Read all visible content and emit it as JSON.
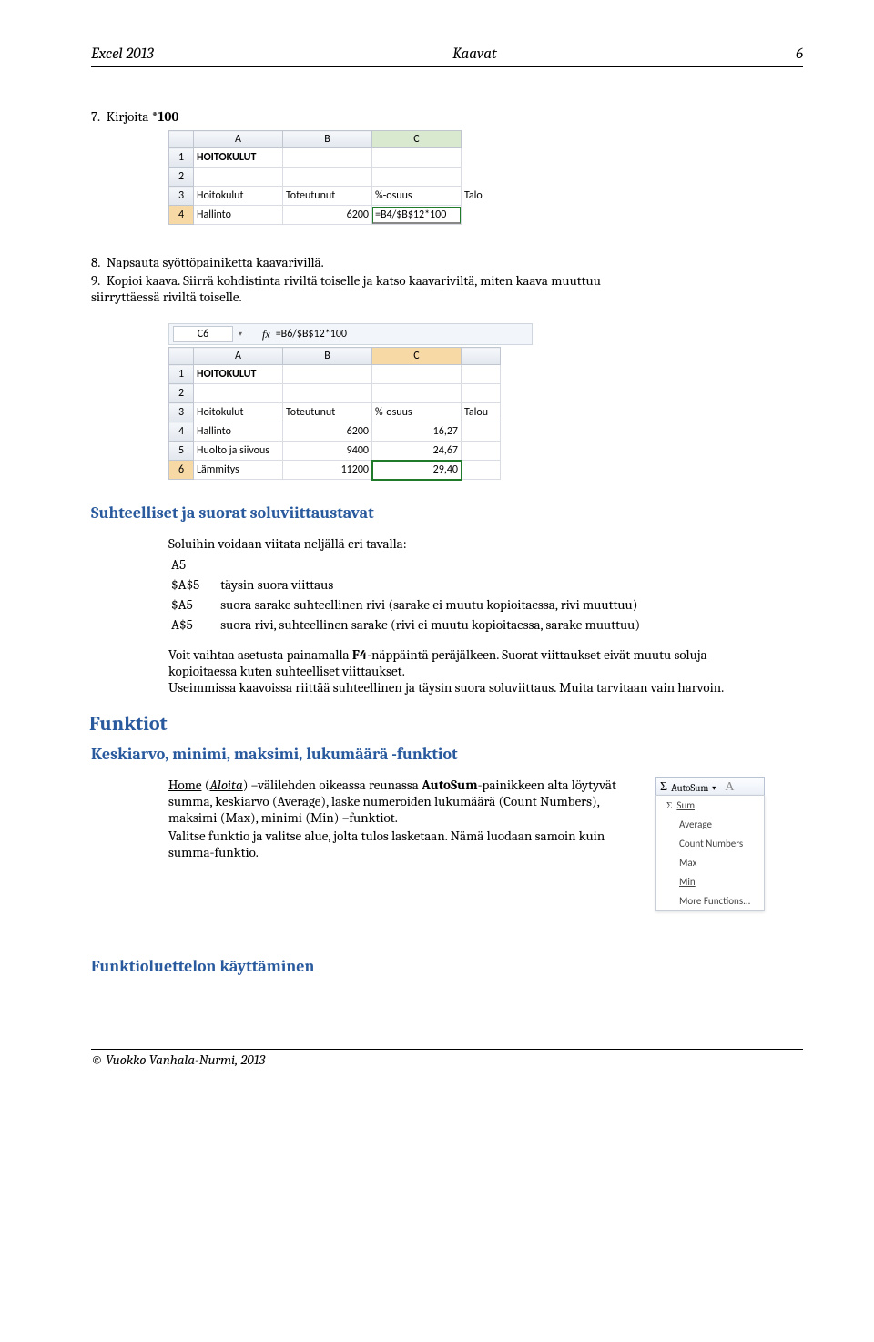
{
  "header": {
    "left": "Excel 2013",
    "center": "Kaavat",
    "right": "6"
  },
  "steps": {
    "s7_prefix": "7.  Kirjoita ",
    "s7_bold": "*100",
    "s8": "8.  Napsauta syöttöpainiketta kaavarivillä.",
    "s9": "9.  Kopioi kaava. Siirrä kohdistinta riviltä toiselle ja katso kaavariviltä, miten kaava muuttuu siirryttäessä riviltä toiselle."
  },
  "tbl1": {
    "cols": [
      "",
      "A",
      "B",
      "C"
    ],
    "rows": [
      {
        "n": "1",
        "a": "HOITOKULUT",
        "b": "",
        "c": ""
      },
      {
        "n": "2",
        "a": "",
        "b": "",
        "c": ""
      },
      {
        "n": "3",
        "a": "Hoitokulut",
        "b": "Toteutunut",
        "c": "%-osuus",
        "d": "Talo"
      },
      {
        "n": "4",
        "a": "Hallinto",
        "b": "6200",
        "c": "=B4/$B$12*100"
      }
    ]
  },
  "fxbar": {
    "name": "C6",
    "fx_label": "fx",
    "formula": "=B6/$B$12*100"
  },
  "tbl2": {
    "cols": [
      "",
      "A",
      "B",
      "C"
    ],
    "rows": [
      {
        "n": "1",
        "a": "HOITOKULUT",
        "b": "",
        "c": "",
        "d": ""
      },
      {
        "n": "2",
        "a": "",
        "b": "",
        "c": "",
        "d": ""
      },
      {
        "n": "3",
        "a": "Hoitokulut",
        "b": "Toteutunut",
        "c": "%-osuus",
        "d": "Talou"
      },
      {
        "n": "4",
        "a": "Hallinto",
        "b": "6200",
        "c": "16,27",
        "d": ""
      },
      {
        "n": "5",
        "a": "Huolto ja siivous",
        "b": "9400",
        "c": "24,67",
        "d": ""
      },
      {
        "n": "6",
        "a": "Lämmitys",
        "b": "11200",
        "c": "29,40",
        "d": ""
      }
    ]
  },
  "sec_refs": {
    "title": "Suhteelliset ja suorat soluviittaustavat",
    "intro": "Soluihin voidaan viitata neljällä eri tavalla:",
    "rows": [
      {
        "a": "A5",
        "b": ""
      },
      {
        "a": "$A$5",
        "b": "täysin suora viittaus"
      },
      {
        "a": "$A5",
        "b": "suora sarake suhteellinen rivi (sarake ei muutu kopioitaessa, rivi muuttuu)"
      },
      {
        "a": "A$5",
        "b": "suora rivi, suhteellinen  sarake  (rivi ei muutu kopioitaessa, sarake muuttuu)"
      }
    ],
    "para1a": "Voit vaihtaa asetusta painamalla ",
    "para1b": "F4",
    "para1c": "-näppäintä peräjälkeen. Suorat viittaukset eivät  muutu soluja kopioitaessa kuten suhteelliset viittaukset.",
    "para2": "Useimmissa kaavoissa riittää suhteellinen ja täysin suora soluviittaus. Muita tarvitaan vain harvoin."
  },
  "sec_funcs": {
    "title": "Funktiot",
    "subtitle": "Keskiarvo, minimi, maksimi, lukumäärä -funktiot",
    "para_a": "Home",
    "para_b": " (",
    "para_c": "Aloita",
    "para_d": ") –välilehden oikeassa reunassa ",
    "para_e": "AutoSum",
    "para_f": "-painikkeen alta löytyvät summa, keskiarvo (Average), laske numeroiden lukumäärä (Count Numbers), maksimi (Max), minimi (Min) –funktiot.",
    "para_g": "Valitse funktio ja valitse alue, jolta tulos lasketaan. Nämä luodaan samoin kuin summa-funktio."
  },
  "autosum": {
    "button": "AutoSum",
    "items": [
      "Sum",
      "Average",
      "Count Numbers",
      "Max",
      "Min",
      "More Functions..."
    ]
  },
  "sec_flist": {
    "title": "Funktioluettelon käyttäminen"
  },
  "footer": "© Vuokko Vanhala-Nurmi, 2013"
}
